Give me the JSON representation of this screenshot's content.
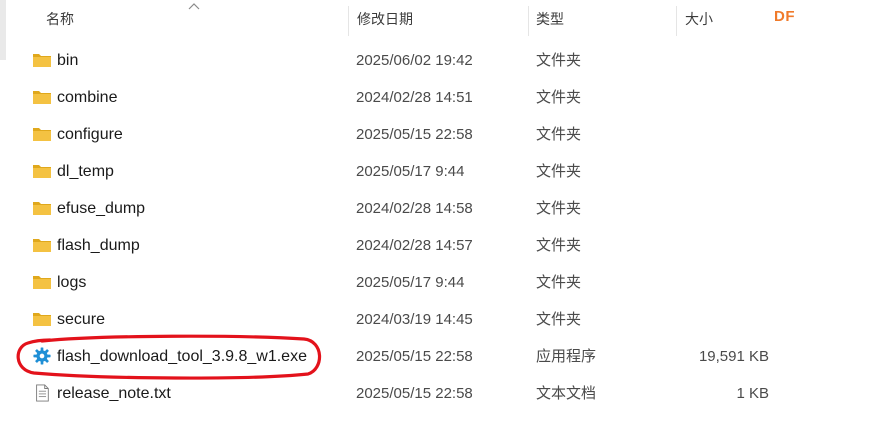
{
  "header": {
    "name": "名称",
    "date_modified": "修改日期",
    "type": "类型",
    "size": "大小",
    "badge": "DF"
  },
  "colors": {
    "folder": "#f4c242",
    "folder_dark": "#e0a81c",
    "exe_gear": "#1f8fd6",
    "annotation": "#e3121b",
    "badge": "#f07a2a"
  },
  "files": [
    {
      "name": "bin",
      "date": "2025/06/02 19:42",
      "type": "文件夹",
      "size": "",
      "icon": "folder-icon"
    },
    {
      "name": "combine",
      "date": "2024/02/28 14:51",
      "type": "文件夹",
      "size": "",
      "icon": "folder-icon"
    },
    {
      "name": "configure",
      "date": "2025/05/15 22:58",
      "type": "文件夹",
      "size": "",
      "icon": "folder-icon"
    },
    {
      "name": "dl_temp",
      "date": "2025/05/17 9:44",
      "type": "文件夹",
      "size": "",
      "icon": "folder-icon"
    },
    {
      "name": "efuse_dump",
      "date": "2024/02/28 14:58",
      "type": "文件夹",
      "size": "",
      "icon": "folder-icon"
    },
    {
      "name": "flash_dump",
      "date": "2024/02/28 14:57",
      "type": "文件夹",
      "size": "",
      "icon": "folder-icon"
    },
    {
      "name": "logs",
      "date": "2025/05/17 9:44",
      "type": "文件夹",
      "size": "",
      "icon": "folder-icon"
    },
    {
      "name": "secure",
      "date": "2024/03/19 14:45",
      "type": "文件夹",
      "size": "",
      "icon": "folder-icon"
    },
    {
      "name": "flash_download_tool_3.9.8_w1.exe",
      "date": "2025/05/15 22:58",
      "type": "应用程序",
      "size": "19,591 KB",
      "icon": "gear-icon"
    },
    {
      "name": "release_note.txt",
      "date": "2025/05/15 22:58",
      "type": "文本文档",
      "size": "1 KB",
      "icon": "text-file-icon"
    }
  ]
}
